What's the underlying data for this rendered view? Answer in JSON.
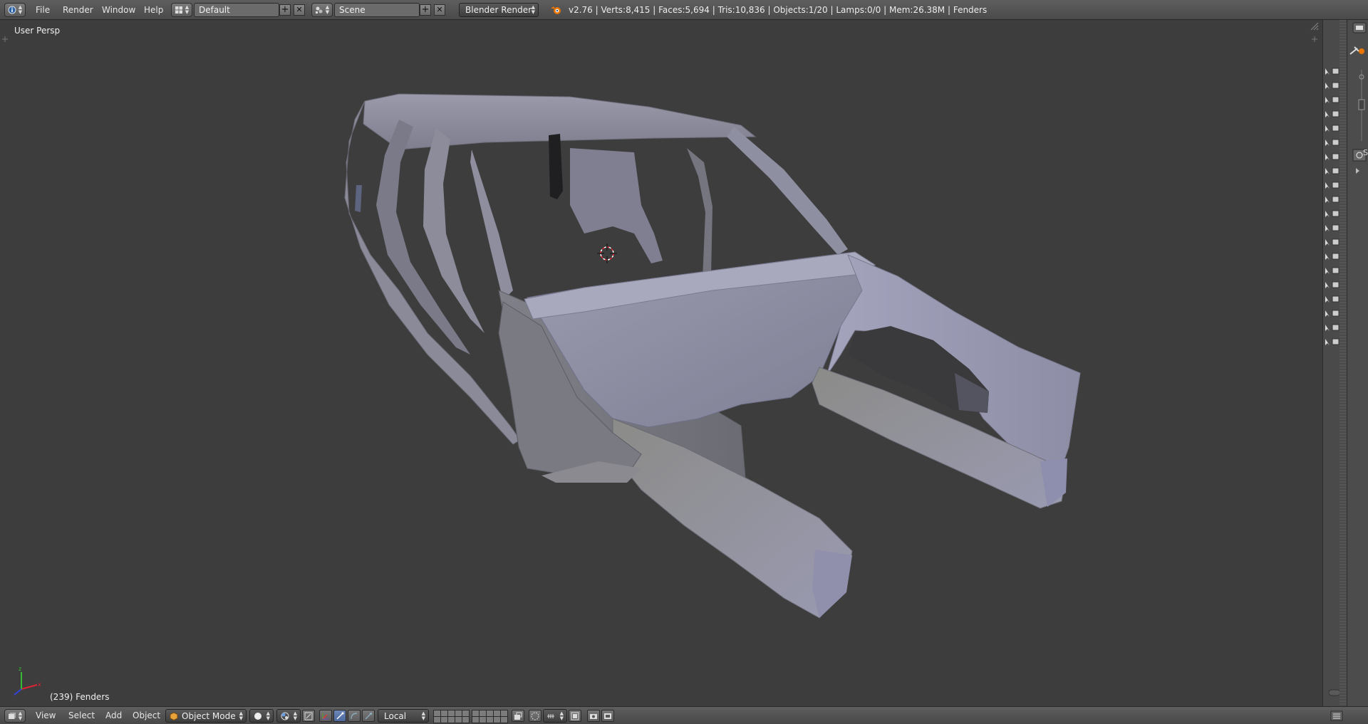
{
  "topbar": {
    "menus": [
      "File",
      "Render",
      "Window",
      "Help"
    ],
    "screen_layout": "Default",
    "scene": "Scene",
    "render_engine": "Blender Render",
    "stats": "v2.76 | Verts:8,415 | Faces:5,694 | Tris:10,836 | Objects:1/20 | Lamps:0/0 | Mem:26.38M | Fenders"
  },
  "viewport": {
    "view_label": "User Persp",
    "object_label": "(239) Fenders",
    "background_color": "#3d3d3d",
    "mesh_color": "#8f8fa3"
  },
  "bottombar": {
    "menus": [
      "View",
      "Select",
      "Add",
      "Object"
    ],
    "mode": "Object Mode",
    "transform_orientation": "Local"
  },
  "props_strip": {
    "tab_label": "S"
  },
  "icons": {
    "editor_type": "info-icon",
    "screen": "screen-layout-icon",
    "scene": "scene-icon",
    "blender_logo": "blender-logo-icon",
    "viewport_shading": "solid-shading-icon",
    "pivot": "pivot-icon",
    "manipulator_translate": "translate-manipulator-icon",
    "manipulator_rotate": "rotate-manipulator-icon",
    "manipulator_scale": "scale-manipulator-icon",
    "layers": "layers-icon",
    "snap": "magnet-icon",
    "render_still": "camera-icon"
  }
}
